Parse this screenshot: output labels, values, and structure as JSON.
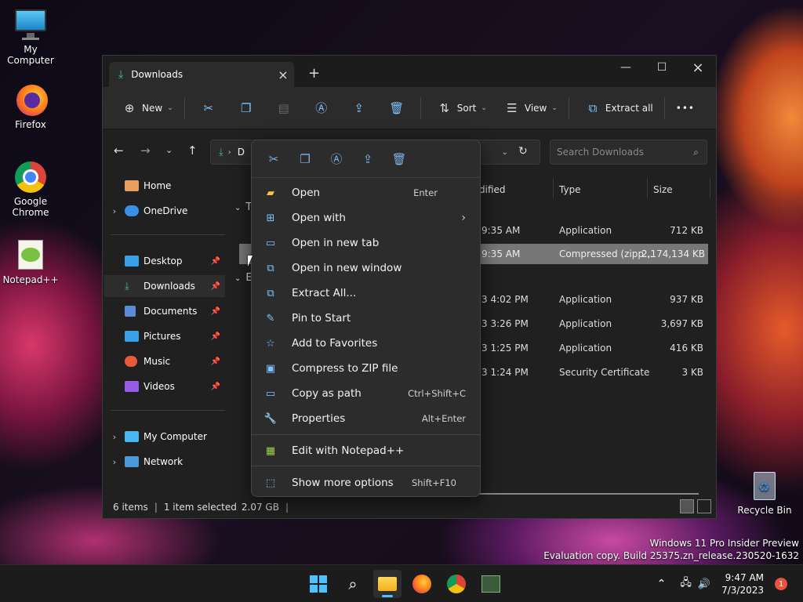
{
  "desktop": {
    "icons": [
      {
        "label": "My Computer"
      },
      {
        "label": "Firefox"
      },
      {
        "label": "Google Chrome"
      },
      {
        "label": "Notepad++"
      },
      {
        "label": "Recycle Bin"
      }
    ]
  },
  "explorer": {
    "tab_title": "Downloads",
    "commands": {
      "new": "New",
      "sort": "Sort",
      "view": "View",
      "extract_all": "Extract all",
      "more": "•••"
    },
    "address": "D",
    "search_placeholder": "Search Downloads",
    "sidebar": {
      "home": "Home",
      "onedrive": "OneDrive",
      "desktop": "Desktop",
      "downloads": "Downloads",
      "documents": "Documents",
      "pictures": "Pictures",
      "music": "Music",
      "videos": "Videos",
      "my_computer": "My Computer",
      "network": "Network"
    },
    "columns": {
      "modified": "dified",
      "type": "Type",
      "size": "Size"
    },
    "groups": {
      "today": "T",
      "earlier": "E"
    },
    "rows": [
      {
        "date": "9:35 AM",
        "type": "Application",
        "size": "712 KB"
      },
      {
        "date": "9:35 AM",
        "type": "Compressed (zipp...",
        "size": "2,174,134 KB"
      },
      {
        "date": "3 4:02 PM",
        "type": "Application",
        "size": "937 KB"
      },
      {
        "date": "3 3:26 PM",
        "type": "Application",
        "size": "3,697 KB"
      },
      {
        "date": "3 1:25 PM",
        "type": "Application",
        "size": "416 KB"
      },
      {
        "date": "3 1:24 PM",
        "type": "Security Certificate",
        "size": "3 KB"
      }
    ],
    "status": {
      "items": "6 items",
      "selected": "1 item selected",
      "size": "2.07 GB"
    }
  },
  "context_menu": {
    "items": [
      {
        "label": "Open",
        "shortcut": "Enter"
      },
      {
        "label": "Open with",
        "shortcut": ""
      },
      {
        "label": "Open in new tab",
        "shortcut": ""
      },
      {
        "label": "Open in new window",
        "shortcut": ""
      },
      {
        "label": "Extract All...",
        "shortcut": ""
      },
      {
        "label": "Pin to Start",
        "shortcut": ""
      },
      {
        "label": "Add to Favorites",
        "shortcut": ""
      },
      {
        "label": "Compress to ZIP file",
        "shortcut": ""
      },
      {
        "label": "Copy as path",
        "shortcut": "Ctrl+Shift+C"
      },
      {
        "label": "Properties",
        "shortcut": "Alt+Enter"
      },
      {
        "label": "Edit with Notepad++",
        "shortcut": ""
      },
      {
        "label": "Show more options",
        "shortcut": "Shift+F10"
      }
    ]
  },
  "taskbar": {
    "time": "9:47 AM",
    "date": "7/3/2023",
    "notification_count": "1"
  },
  "watermark": {
    "line1": "Windows 11 Pro Insider Preview",
    "line2": "Evaluation copy. Build 25375.zn_release.230520-1632"
  },
  "colors": {
    "accent": "#4cc2ff",
    "selection": "#777777",
    "menu_bg": "#2c2c2c"
  }
}
